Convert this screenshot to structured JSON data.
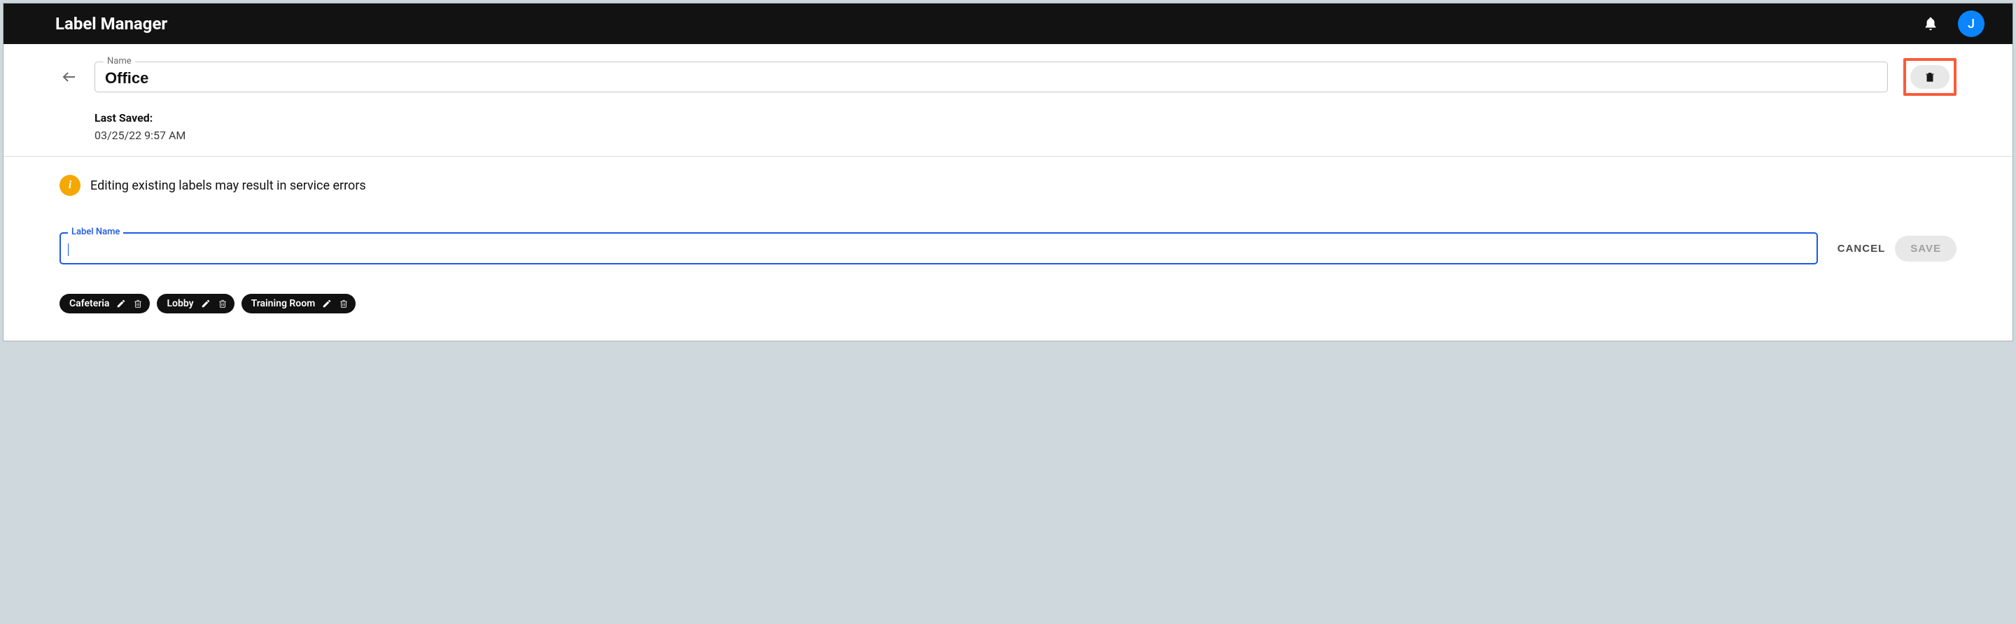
{
  "header": {
    "title": "Label Manager",
    "avatar_initial": "J"
  },
  "name_field": {
    "label": "Name",
    "value": "Office"
  },
  "last_saved": {
    "label": "Last Saved:",
    "value": "03/25/22 9:57 AM"
  },
  "info_message": "Editing existing labels may result in service errors",
  "label_name": {
    "label": "Label Name",
    "value": ""
  },
  "actions": {
    "cancel": "CANCEL",
    "save": "SAVE"
  },
  "chips": [
    {
      "label": "Cafeteria"
    },
    {
      "label": "Lobby"
    },
    {
      "label": "Training Room"
    }
  ]
}
